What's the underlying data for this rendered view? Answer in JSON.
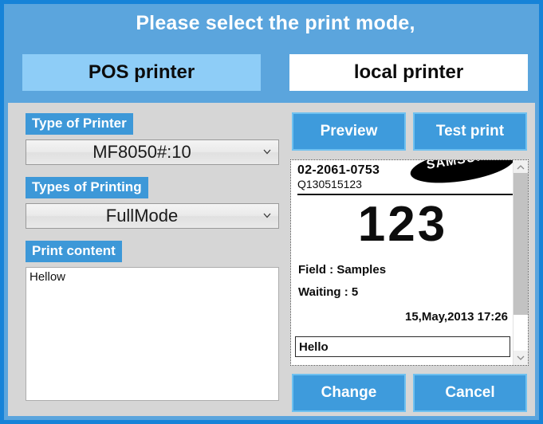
{
  "dialog": {
    "title": "Please select the print mode,"
  },
  "mode_tabs": [
    {
      "label": "POS printer",
      "active": true
    },
    {
      "label": "local printer",
      "active": false
    }
  ],
  "left_panel": {
    "printer_type": {
      "label": "Type of Printer",
      "value": "MF8050#:10"
    },
    "printing_type": {
      "label": "Types of Printing",
      "value": "FullMode"
    },
    "print_content": {
      "label": "Print content",
      "value": "Hellow",
      "placeholder": ""
    }
  },
  "right_panel": {
    "buttons": {
      "preview": "Preview",
      "test_print": "Test print",
      "change": "Change",
      "cancel": "Cancel"
    },
    "preview": {
      "phone": "02-2061-0753",
      "code": "Q130515123",
      "logo_text": "SAMSUNG",
      "ticket_number": "123",
      "field_line": "Field : Samples",
      "waiting_line": "Waiting : 5",
      "datetime": "15,May,2013  17:26",
      "input_value": "Hello"
    }
  },
  "colors": {
    "frame_border": "#1683d8",
    "header_band": "#5ba5dd",
    "body_panel": "#d6d6d6",
    "tab_active": "#8ecdf7",
    "tab_inactive": "#ffffff",
    "label_badge": "#3d98d8",
    "button_fill": "#3e9bdc",
    "button_border": "#6fc1f0"
  }
}
